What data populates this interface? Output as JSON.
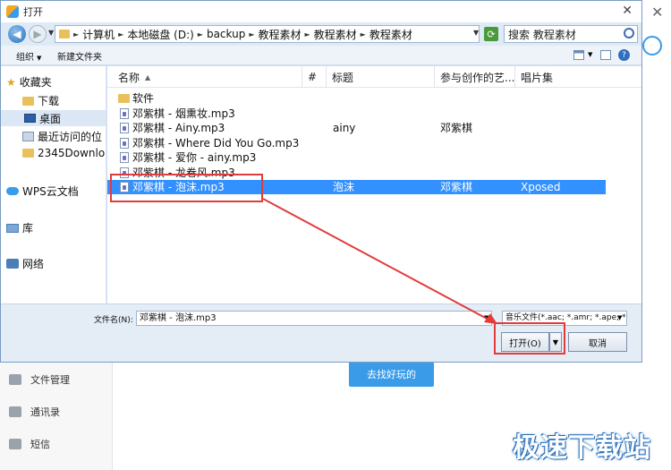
{
  "background": {
    "nav": [
      "文件管理",
      "通讯录",
      "短信"
    ],
    "cta_button": "去找好玩的",
    "watermark": "极速下载站"
  },
  "dialog": {
    "title": "打开",
    "address": {
      "crumbs": [
        "计算机",
        "本地磁盘 (D:)",
        "backup",
        "教程素材",
        "教程素材",
        "教程素材"
      ],
      "search_placeholder": "搜索 教程素材"
    },
    "toolbar": {
      "organize": "组织",
      "new_folder": "新建文件夹"
    },
    "sidebar": {
      "favorites": "收藏夹",
      "items": [
        "下载",
        "桌面",
        "最近访问的位",
        "2345Downlo"
      ],
      "wps": "WPS云文档",
      "library": "库",
      "network": "网络"
    },
    "columns": [
      "名称",
      "#",
      "标题",
      "参与创作的艺...",
      "唱片集"
    ],
    "files": [
      {
        "name": "软件",
        "num": "",
        "title": "",
        "artist": "",
        "album": "",
        "type": "folder"
      },
      {
        "name": "邓紫棋 - 烟熏妆.mp3",
        "num": "",
        "title": "",
        "artist": "",
        "album": "",
        "type": "file"
      },
      {
        "name": "邓紫棋 - Ainy.mp3",
        "num": "",
        "title": "ainy",
        "artist": "邓紫棋",
        "album": "",
        "type": "file"
      },
      {
        "name": "邓紫棋 - Where Did You Go.mp3",
        "num": "",
        "title": "",
        "artist": "",
        "album": "",
        "type": "file"
      },
      {
        "name": "邓紫棋 - 爱你 - ainy.mp3",
        "num": "",
        "title": "",
        "artist": "",
        "album": "",
        "type": "file"
      },
      {
        "name": "邓紫棋 - 龙卷风.mp3",
        "num": "",
        "title": "",
        "artist": "",
        "album": "",
        "type": "file"
      },
      {
        "name": "邓紫棋 - 泡沫.mp3",
        "num": "",
        "title": "泡沫",
        "artist": "邓紫棋",
        "album": "Xposed",
        "type": "file",
        "selected": true
      }
    ],
    "filename_label": "文件名(N):",
    "filename_value": "邓紫棋 - 泡沫.mp3",
    "filetype_value": "音乐文件(*.aac; *.amr; *.ape; *",
    "open_button": "打开(O)",
    "cancel_button": "取消"
  },
  "colors": {
    "selection": "#3390ff",
    "annotation": "#e23b3b",
    "accent": "#3a9be8"
  }
}
